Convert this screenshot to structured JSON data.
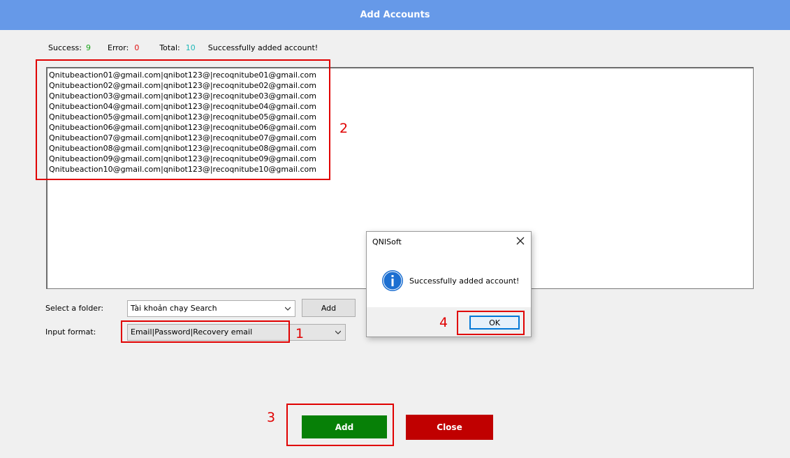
{
  "window": {
    "title": "Add Accounts"
  },
  "stats": {
    "success_label": "Success:",
    "success_value": "9",
    "error_label": "Error:",
    "error_value": "0",
    "total_label": "Total:",
    "total_value": "10",
    "message": "Successfully added account!"
  },
  "accounts": [
    "Qnitubeaction01@gmail.com|qnibot123@|recoqnitube01@gmail.com",
    "Qnitubeaction02@gmail.com|qnibot123@|recoqnitube02@gmail.com",
    "Qnitubeaction03@gmail.com|qnibot123@|recoqnitube03@gmail.com",
    "Qnitubeaction04@gmail.com|qnibot123@|recoqnitube04@gmail.com",
    "Qnitubeaction05@gmail.com|qnibot123@|recoqnitube05@gmail.com",
    "Qnitubeaction06@gmail.com|qnibot123@|recoqnitube06@gmail.com",
    "Qnitubeaction07@gmail.com|qnibot123@|recoqnitube07@gmail.com",
    "Qnitubeaction08@gmail.com|qnibot123@|recoqnitube08@gmail.com",
    "Qnitubeaction09@gmail.com|qnibot123@|recoqnitube09@gmail.com",
    "Qnitubeaction10@gmail.com|qnibot123@|recoqnitube10@gmail.com"
  ],
  "form": {
    "folder_label": "Select a folder:",
    "folder_value": "Tài khoản chạy Search",
    "folder_add_label": "Add",
    "format_label": "Input format:",
    "format_value": "Email|Password|Recovery email"
  },
  "actions": {
    "add_label": "Add",
    "close_label": "Close",
    "add_color": "#078007",
    "close_color": "#c00000"
  },
  "dialog": {
    "title": "QNISoft",
    "message": "Successfully added account!",
    "ok_label": "OK",
    "icon": "info-icon"
  },
  "annotations": {
    "n1": "1",
    "n2": "2",
    "n3": "3",
    "n4": "4",
    "color": "#e00000"
  }
}
